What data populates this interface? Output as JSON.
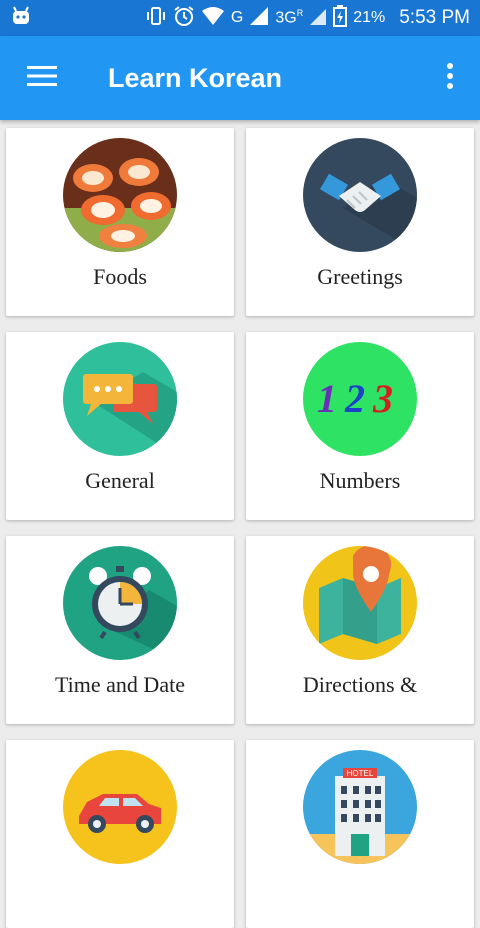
{
  "status_bar": {
    "battery_percent": "21%",
    "network": "G",
    "network_secondary": "3G",
    "roaming": "R",
    "time": "5:53 PM"
  },
  "app_bar": {
    "title": "Learn Korean"
  },
  "categories": [
    {
      "label": "Foods",
      "icon": "sushi-icon"
    },
    {
      "label": "Greetings",
      "icon": "handshake-icon"
    },
    {
      "label": "General",
      "icon": "chat-bubbles-icon"
    },
    {
      "label": "Numbers",
      "icon": "numbers-123-icon"
    },
    {
      "label": "Time and Date",
      "icon": "alarm-clock-icon"
    },
    {
      "label": "Directions &",
      "icon": "map-pin-icon"
    },
    {
      "label": "",
      "icon": "car-icon"
    },
    {
      "label": "",
      "icon": "hotel-icon"
    }
  ],
  "hotel_sign": "HOTEL",
  "numbers_icon_text": [
    "1",
    "2",
    "3"
  ],
  "colors": {
    "status_bar": "#1976d2",
    "app_bar": "#2196f3",
    "background": "#ececec"
  }
}
